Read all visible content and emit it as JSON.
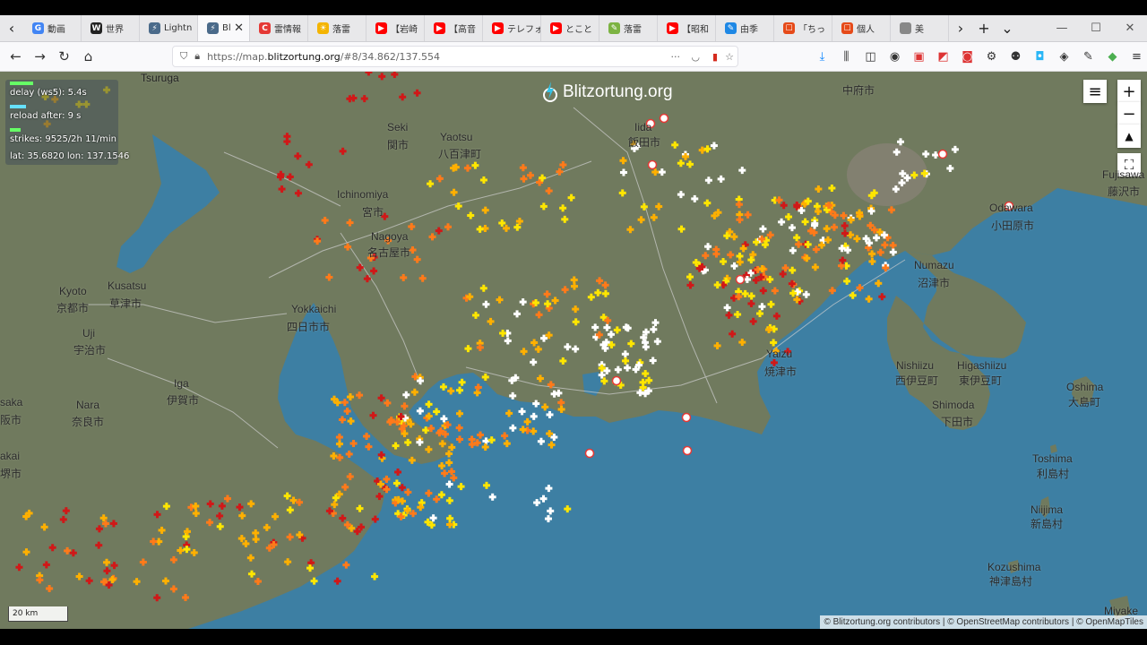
{
  "browser": {
    "tabs": [
      {
        "label": "動画",
        "fav": "G",
        "color": "#4285f4"
      },
      {
        "label": "世界",
        "fav": "W",
        "color": "#222222"
      },
      {
        "label": "Lightn",
        "fav": "⚡",
        "color": "#4a6a8a"
      },
      {
        "label": "Bl",
        "fav": "⚡",
        "color": "#4a6a8a",
        "active": true
      },
      {
        "label": "雷情報",
        "fav": "C",
        "color": "#e53935"
      },
      {
        "label": "落雷",
        "fav": "☀",
        "color": "#f4b400"
      },
      {
        "label": "【岩崎",
        "fav": "▶",
        "color": "#ff0000"
      },
      {
        "label": "【高音",
        "fav": "▶",
        "color": "#ff0000"
      },
      {
        "label": "テレフォ",
        "fav": "▶",
        "color": "#ff0000"
      },
      {
        "label": "とこと",
        "fav": "▶",
        "color": "#ff0000"
      },
      {
        "label": "落雷",
        "fav": "✎",
        "color": "#7cb342"
      },
      {
        "label": "【昭和",
        "fav": "▶",
        "color": "#ff0000"
      },
      {
        "label": "由季",
        "fav": "✎",
        "color": "#1e88e5"
      },
      {
        "label": "「ちっ",
        "fav": "☐",
        "color": "#e64a19"
      },
      {
        "label": "個人",
        "fav": "☐",
        "color": "#e64a19"
      },
      {
        "label": "美",
        "fav": "",
        "color": "#888888"
      }
    ],
    "url_prefix": "https://map.",
    "url_domain": "blitzortung.org",
    "url_suffix": "/#8/34.862/137.554"
  },
  "info_panel": {
    "delay": "delay (ws5): 5.4s",
    "reload": "reload after: 9 s",
    "strikes": "strikes: 9525/2h 11/min",
    "coords": "lat: 35.6820 lon: 137.1546"
  },
  "logo": "Blitzortung.org",
  "scale_label": "20 km",
  "attribution": "© Blitzortung.org contributors | © OpenStreetMap contributors | © OpenMapTiles",
  "map_labels": [
    {
      "text": "Tsuruga"
    },
    {
      "text": "Seki"
    },
    {
      "text": "関市"
    },
    {
      "text": "Yaotsu"
    },
    {
      "text": "八百津町"
    },
    {
      "text": "Iida"
    },
    {
      "text": "飯田市"
    },
    {
      "text": "中府市"
    },
    {
      "text": "Ichinomiya"
    },
    {
      "text": "宮市"
    },
    {
      "text": "Nagoya"
    },
    {
      "text": "名古屋市"
    },
    {
      "text": "Kyoto"
    },
    {
      "text": "京都市"
    },
    {
      "text": "Kusatsu"
    },
    {
      "text": "草津市"
    },
    {
      "text": "Yokkaichi"
    },
    {
      "text": "四日市市"
    },
    {
      "text": "Uji"
    },
    {
      "text": "宇治市"
    },
    {
      "text": "Iga"
    },
    {
      "text": "伊賀市"
    },
    {
      "text": "Nara"
    },
    {
      "text": "奈良市"
    },
    {
      "text": "Yaizu"
    },
    {
      "text": "焼津市"
    },
    {
      "text": "Numazu"
    },
    {
      "text": "沼津市"
    },
    {
      "text": "Odawara"
    },
    {
      "text": "小田原市"
    },
    {
      "text": "Fujisawa"
    },
    {
      "text": "藤沢市"
    },
    {
      "text": "Nishiizu"
    },
    {
      "text": "西伊豆町"
    },
    {
      "text": "Higashiizu"
    },
    {
      "text": "東伊豆町"
    },
    {
      "text": "Shimoda"
    },
    {
      "text": "下田市"
    },
    {
      "text": "Oshima"
    },
    {
      "text": "大島町"
    },
    {
      "text": "Toshima"
    },
    {
      "text": "利島村"
    },
    {
      "text": "Niijima"
    },
    {
      "text": "新島村"
    },
    {
      "text": "Kozushima"
    },
    {
      "text": "神津島村"
    },
    {
      "text": "Miyake"
    },
    {
      "text": "saka"
    },
    {
      "text": "阪市"
    },
    {
      "text": "akai"
    },
    {
      "text": "堺市"
    }
  ],
  "strike_colors": {
    "new": "#ffffff",
    "recent": "#ffe600",
    "mid": "#ffb000",
    "older": "#ff7a1a",
    "old": "#d01818"
  },
  "colors": {
    "land": "#707a5e",
    "sea": "#3d7fa3",
    "road": "#cfcfcf"
  }
}
